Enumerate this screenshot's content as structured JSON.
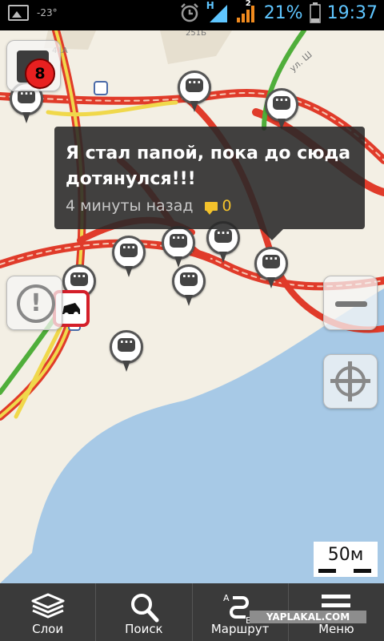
{
  "status_bar": {
    "temperature": "-23°",
    "network_h_label": "H",
    "sim_label": "2",
    "battery_percent": "21%",
    "time": "19:37"
  },
  "map": {
    "street_labels": [
      "251Б",
      "41А",
      "ул. Ш"
    ],
    "traffic_score": "8",
    "accent_colors": {
      "traffic_red": "#e03b2a",
      "traffic_yellow": "#f0d84b",
      "traffic_green": "#4fae3a",
      "water": "#a7c9e6"
    },
    "scale": "50м"
  },
  "popup": {
    "message": "Я стал папой, пока до сюда дотянулся!!!",
    "time_ago": "4 минуты назад",
    "comments_count": "0"
  },
  "bottom_nav": {
    "items": [
      {
        "label": "Слои",
        "icon": "layers-icon"
      },
      {
        "label": "Поиск",
        "icon": "search-icon"
      },
      {
        "label": "Маршрут",
        "icon": "route-icon"
      },
      {
        "label": "Меню",
        "icon": "menu-icon"
      }
    ]
  },
  "watermark": "YAPLAKAL.COM"
}
